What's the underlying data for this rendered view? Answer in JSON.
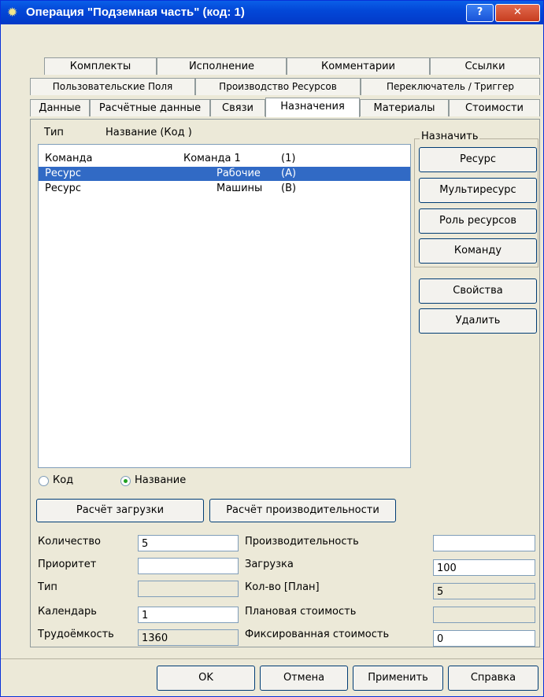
{
  "window": {
    "title": "Операция  \"Подземная часть\" (код: 1)",
    "help": "?",
    "close": "✕"
  },
  "tabs_row1": [
    {
      "label": "Комплекты"
    },
    {
      "label": "Исполнение"
    },
    {
      "label": "Комментарии"
    },
    {
      "label": "Ссылки"
    }
  ],
  "tabs_row2": [
    {
      "label": "Пользовательские Поля"
    },
    {
      "label": "Производство Ресурсов"
    },
    {
      "label": "Переключатель / Триггер"
    }
  ],
  "tabs_row3": [
    {
      "label": "Данные"
    },
    {
      "label": "Расчётные данные"
    },
    {
      "label": "Связи"
    },
    {
      "label": "Назначения"
    },
    {
      "label": "Материалы"
    },
    {
      "label": "Стоимости"
    }
  ],
  "list": {
    "header_type": "Тип",
    "header_name": "Название (Код )",
    "rows": [
      {
        "type": "Команда",
        "name": "Команда 1",
        "code": "(1)"
      },
      {
        "type": "Ресурс",
        "name": "Рабочие",
        "code": "(A)"
      },
      {
        "type": "Ресурс",
        "name": "Машины",
        "code": "(B)"
      }
    ]
  },
  "assign": {
    "title": "Назначить",
    "resource": "Ресурс",
    "multi": "Мультиресурс",
    "role": "Роль ресурсов",
    "team": "Команду",
    "props": "Свойства",
    "delete": "Удалить"
  },
  "display": {
    "code": "Код",
    "name": "Название"
  },
  "calc": {
    "load": "Расчёт загрузки",
    "perf": "Расчёт производительности"
  },
  "fields": {
    "qty": {
      "label": "Количество",
      "value": "5"
    },
    "priority": {
      "label": "Приоритет",
      "value": ""
    },
    "type": {
      "label": "Тип",
      "value": ""
    },
    "calendar": {
      "label": "Календарь",
      "value": "1"
    },
    "labor": {
      "label": "Трудоёмкость",
      "value": "1360"
    },
    "perf": {
      "label": "Производительность",
      "value": ""
    },
    "load": {
      "label": "Загрузка",
      "value": "100"
    },
    "qty_plan": {
      "label": "Кол-во [План]",
      "value": "5"
    },
    "plan_cost": {
      "label": "Плановая стоимость",
      "value": ""
    },
    "fixed_cost": {
      "label": "Фиксированная стоимость",
      "value": "0"
    }
  },
  "footer": {
    "ok": "OK",
    "cancel": "Отмена",
    "apply": "Применить",
    "help": "Справка"
  }
}
